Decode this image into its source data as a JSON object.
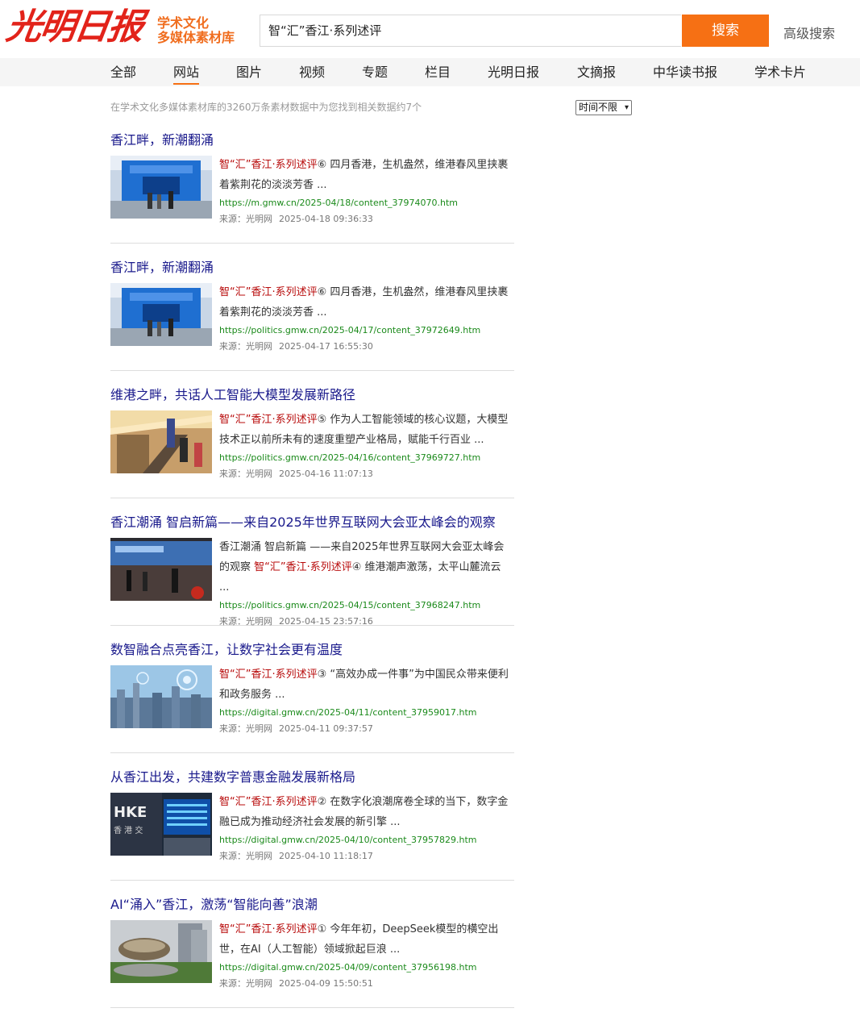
{
  "header": {
    "logo_text": "光明日报",
    "sublabel_line1": "学术文化",
    "sublabel_line2": "多媒体素材库",
    "search_value": "智“汇”香江·系列述评",
    "search_button": "搜索",
    "advanced_search": "高级搜索"
  },
  "nav": {
    "tabs": [
      "全部",
      "网站",
      "图片",
      "视频",
      "专题",
      "栏目",
      "光明日报",
      "文摘报",
      "中华读书报",
      "学术卡片"
    ],
    "active_tab": "网站"
  },
  "summary": {
    "text": "在学术文化多媒体素材库的3260万条素材数据中为您找到相关数据约7个",
    "time_filter": "时间不限"
  },
  "colors": {
    "accent": "#f67014",
    "title_link": "#1a1a8c",
    "highlight": "#b80b0b",
    "url": "#1b8a1b"
  },
  "results": [
    {
      "title": "香江畔，新潮翻涌",
      "snippet_prefix": "",
      "snippet_highlight": "智“汇”香江·系列述评",
      "snippet_text": "⑥ 四月香港，生机盎然，维港春风里挟裹着紫荆花的淡淡芳香 ...",
      "url": "https://m.gmw.cn/2025-04/18/content_37974070.htm",
      "source": "来源：光明网",
      "date": "2025-04-18 09:36:33",
      "thumb": "stage"
    },
    {
      "title": "香江畔，新潮翻涌",
      "snippet_prefix": "",
      "snippet_highlight": "智“汇”香江·系列述评",
      "snippet_text": "⑥ 四月香港，生机盎然，维港春风里挟裹着紫荆花的淡淡芳香 ...",
      "url": "https://politics.gmw.cn/2025-04/17/content_37972649.htm",
      "source": "来源：光明网",
      "date": "2025-04-17 16:55:30",
      "thumb": "stage"
    },
    {
      "title": "维港之畔，共话人工智能大模型发展新路径",
      "snippet_prefix": "",
      "snippet_highlight": "智“汇”香江·系列述评",
      "snippet_text": "⑤ 作为人工智能领域的核心议题，大模型技术正以前所未有的速度重塑产业格局，赋能千行百业 ...",
      "url": "https://politics.gmw.cn/2025-04/16/content_37969727.htm",
      "source": "来源：光明网",
      "date": "2025-04-16 11:07:13",
      "thumb": "hall"
    },
    {
      "title": "香江潮涌 智启新篇——来自2025年世界互联网大会亚太峰会的观察",
      "snippet_prefix": "香江潮涌 智启新篇 ——来自2025年世界互联网大会亚太峰会的观察 ",
      "snippet_highlight": "智“汇”香江·系列述评",
      "snippet_text": "④ 维港潮声激荡，太平山麓流云 ...",
      "url": "https://politics.gmw.cn/2025-04/15/content_37968247.htm",
      "source": "来源：光明网",
      "date": "2025-04-15 23:57:16",
      "thumb": "screen"
    },
    {
      "title": "数智融合点亮香江，让数字社会更有温度",
      "snippet_prefix": "",
      "snippet_highlight": "智“汇”香江·系列述评",
      "snippet_text": "③ “高效办成一件事”为中国民众带来便利和政务服务 ...",
      "url": "https://digital.gmw.cn/2025-04/11/content_37959017.htm",
      "source": "来源：光明网",
      "date": "2025-04-11 09:37:57",
      "thumb": "city"
    },
    {
      "title": "从香江出发，共建数字普惠金融发展新格局",
      "snippet_prefix": "",
      "snippet_highlight": "智“汇”香江·系列述评",
      "snippet_text": "② 在数字化浪潮席卷全球的当下，数字金融已成为推动经济社会发展的新引擎 ...",
      "url": "https://digital.gmw.cn/2025-04/10/content_37957829.htm",
      "source": "来源：光明网",
      "date": "2025-04-10 11:18:17",
      "thumb": "hkex"
    },
    {
      "title": "AI“涌入”香江，激荡“智能向善”浪潮",
      "snippet_prefix": "",
      "snippet_highlight": "智“汇”香江·系列述评",
      "snippet_text": "① 今年年初，DeepSeek模型的横空出世，在AI（人工智能）领域掀起巨浪 ...",
      "url": "https://digital.gmw.cn/2025-04/09/content_37956198.htm",
      "source": "来源：光明网",
      "date": "2025-04-09 15:50:51",
      "thumb": "dome"
    }
  ]
}
